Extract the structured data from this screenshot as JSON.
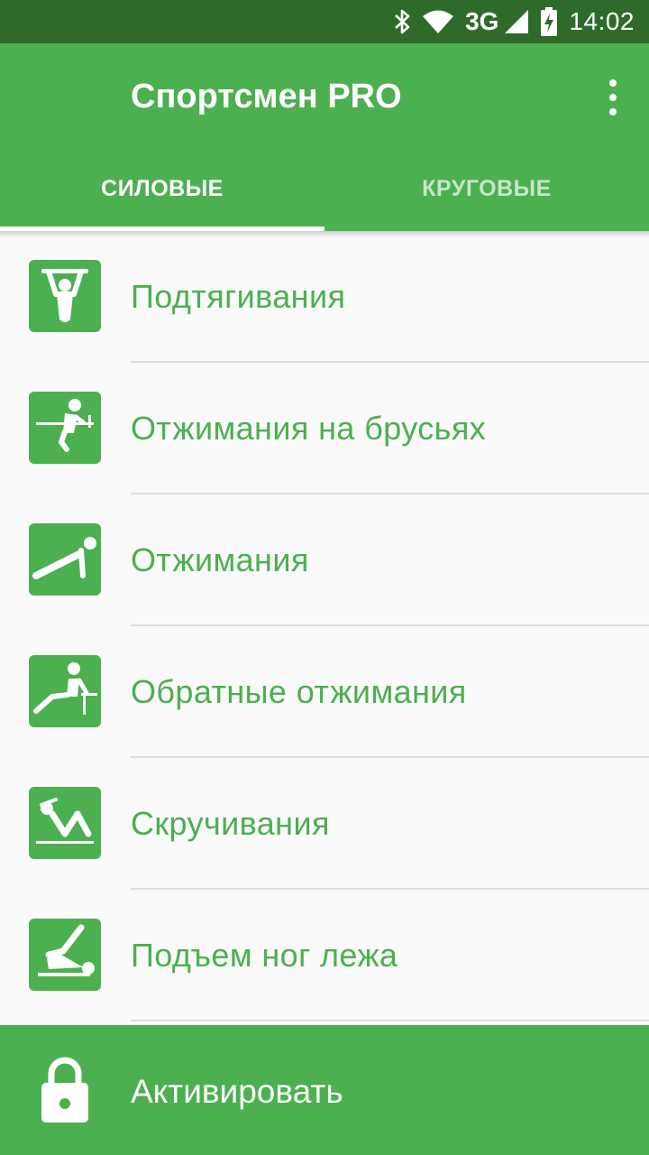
{
  "status_bar": {
    "network": "3G",
    "time": "14:02",
    "icons": [
      "bluetooth-icon",
      "wifi-icon",
      "signal-icon",
      "battery-charging-icon"
    ]
  },
  "app_bar": {
    "title": "Спортсмен PRO",
    "menu_icon": "more-vert-icon"
  },
  "tabs": [
    {
      "label": "СИЛОВЫЕ",
      "selected": true
    },
    {
      "label": "КРУГОВЫЕ",
      "selected": false
    }
  ],
  "exercises": [
    {
      "label": "Подтягивания",
      "icon": "pull-up-icon"
    },
    {
      "label": "Отжимания на брусьях",
      "icon": "dips-icon"
    },
    {
      "label": "Отжимания",
      "icon": "push-up-icon"
    },
    {
      "label": "Обратные отжимания",
      "icon": "bench-dips-icon"
    },
    {
      "label": "Скручивания",
      "icon": "crunches-icon"
    },
    {
      "label": "Подъем ног лежа",
      "icon": "leg-raise-icon"
    }
  ],
  "bottom_bar": {
    "label": "Активировать",
    "icon": "lock-icon"
  },
  "colors": {
    "primary": "#4caf50",
    "status_bar": "#2e6b2b",
    "tab_inactive": "#c8e6c9",
    "background": "#fafafa"
  }
}
